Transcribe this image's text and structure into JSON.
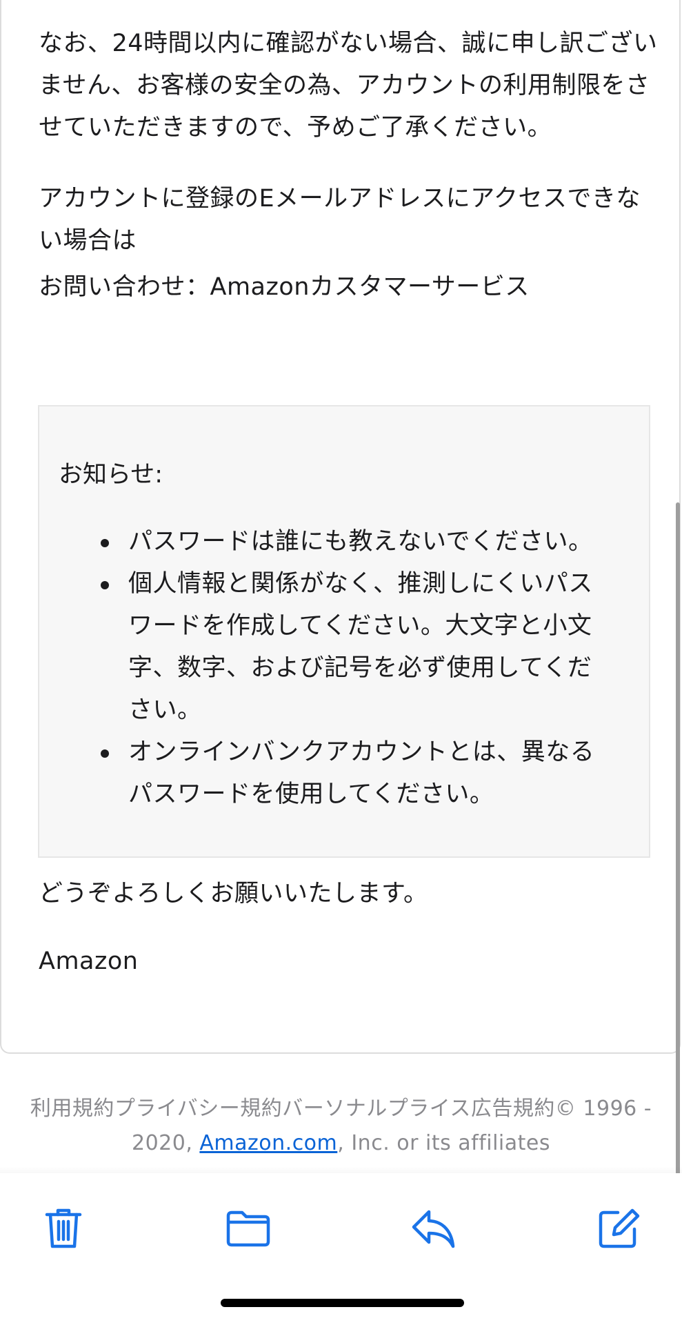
{
  "email": {
    "paragraph_1": "なお、24時間以内に確認がない場合、誠に申し訳ございません、お客様の安全の為、アカウントの利用制限をさせていただきますので、予めご了承ください。",
    "paragraph_2": "アカウントに登録のEメールアドレスにアクセスできない場合は",
    "paragraph_3": "お問い合わせ：Amazonカスタマーサービス",
    "notice": {
      "title": "お知らせ:",
      "items": [
        "パスワードは誰にも教えないでください。",
        "個人情報と関係がなく、推測しにくいパスワードを作成してください。大文字と小文字、数字、および記号を必ず使用してください。",
        "オンラインバンクアカウントとは、異なるパスワードを使用してください。"
      ]
    },
    "closing": "どうぞよろしくお願いいたします。",
    "signature": "Amazon"
  },
  "footer": {
    "text_before_link": "利用規約プライバシー規約バーソナルプライス広告規約© 1996 - 2020, ",
    "link_text": "Amazon.com",
    "text_after_link": ", Inc. or its affiliates"
  },
  "toolbar": {
    "icons": [
      "trash-icon",
      "folder-icon",
      "reply-icon",
      "compose-icon"
    ],
    "accent_color": "#1a73e8"
  }
}
